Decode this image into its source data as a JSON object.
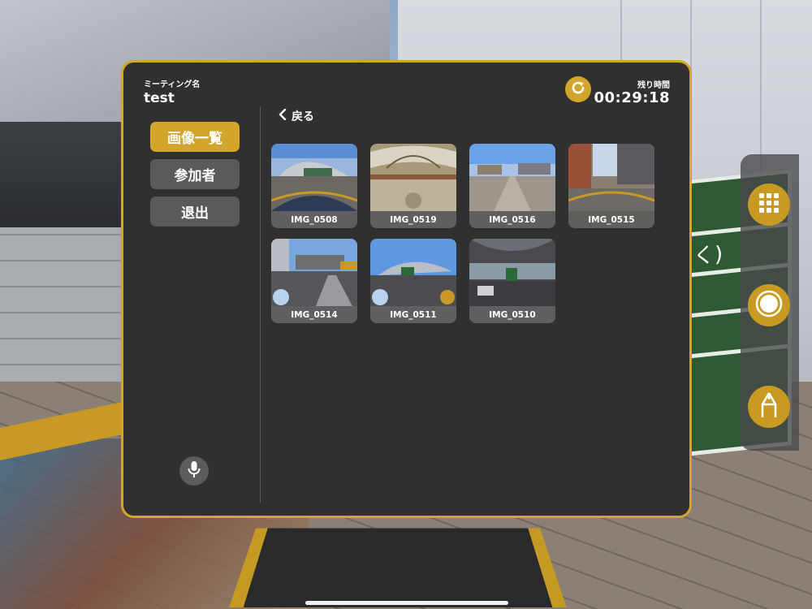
{
  "header": {
    "meeting_label": "ミーティング名",
    "meeting_name": "test",
    "timer_label": "残り時間",
    "timer_value": "00:29:18",
    "refresh_icon": "refresh-icon"
  },
  "sidebar": {
    "items": [
      {
        "label": "画像一覧",
        "active": true
      },
      {
        "label": "参加者",
        "active": false
      },
      {
        "label": "退出",
        "active": false
      }
    ],
    "mic_icon": "microphone-icon"
  },
  "content": {
    "back_label": "戻る",
    "images": [
      {
        "name": "IMG_0508"
      },
      {
        "name": "IMG_0519"
      },
      {
        "name": "IMG_0516"
      },
      {
        "name": "IMG_0515"
      },
      {
        "name": "IMG_0514"
      },
      {
        "name": "IMG_0511"
      },
      {
        "name": "IMG_0510"
      }
    ]
  },
  "toolbar": {
    "buttons": [
      {
        "icon": "grid-icon"
      },
      {
        "icon": "record-icon"
      },
      {
        "icon": "pen-icon"
      }
    ]
  },
  "colors": {
    "accent": "#d3a52b",
    "panel_bg": "#303030",
    "button_gray": "#5a5a5a"
  }
}
